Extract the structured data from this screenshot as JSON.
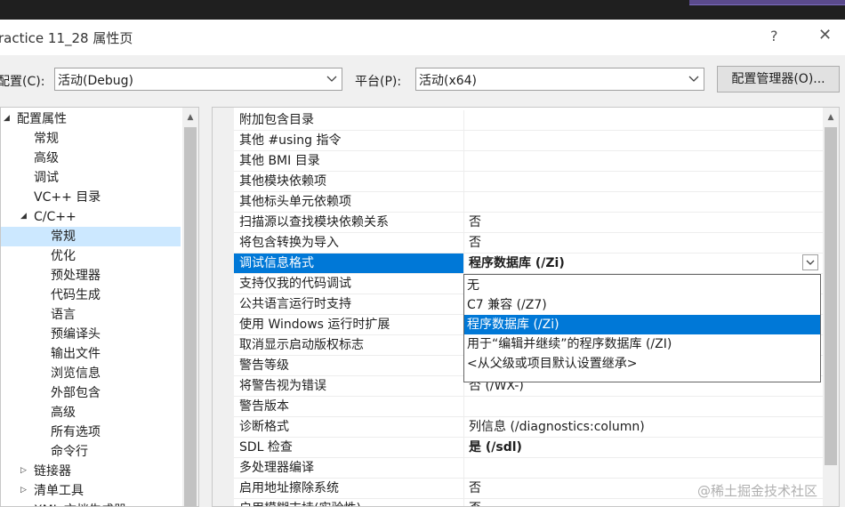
{
  "window": {
    "title": "ractice 11_28 属性页",
    "help": "?",
    "close": "✕"
  },
  "config": {
    "config_label": "配置(C):",
    "config_value": "活动(Debug)",
    "platform_label": "平台(P):",
    "platform_value": "活动(x64)",
    "manager_button": "配置管理器(O)..."
  },
  "tree": {
    "items": [
      {
        "label": "配置属性",
        "level": 0,
        "expander": "◢"
      },
      {
        "label": "常规",
        "level": 1
      },
      {
        "label": "高级",
        "level": 1
      },
      {
        "label": "调试",
        "level": 1
      },
      {
        "label": "VC++ 目录",
        "level": 1
      },
      {
        "label": "C/C++",
        "level": 1,
        "expander": "◢"
      },
      {
        "label": "常规",
        "level": 2,
        "selected": true
      },
      {
        "label": "优化",
        "level": 2
      },
      {
        "label": "预处理器",
        "level": 2
      },
      {
        "label": "代码生成",
        "level": 2
      },
      {
        "label": "语言",
        "level": 2
      },
      {
        "label": "预编译头",
        "level": 2
      },
      {
        "label": "输出文件",
        "level": 2
      },
      {
        "label": "浏览信息",
        "level": 2
      },
      {
        "label": "外部包含",
        "level": 2
      },
      {
        "label": "高级",
        "level": 2
      },
      {
        "label": "所有选项",
        "level": 2
      },
      {
        "label": "命令行",
        "level": 2
      },
      {
        "label": "链接器",
        "level": 1,
        "expander": "▷"
      },
      {
        "label": "清单工具",
        "level": 1,
        "expander": "▷"
      },
      {
        "label": "XML 文档生成器",
        "level": 1,
        "expander": "▷"
      }
    ]
  },
  "properties": {
    "rows": [
      {
        "name": "附加包含目录",
        "value": ""
      },
      {
        "name": "其他 #using 指令",
        "value": ""
      },
      {
        "name": "其他 BMI 目录",
        "value": ""
      },
      {
        "name": "其他模块依赖项",
        "value": ""
      },
      {
        "name": "其他标头单元依赖项",
        "value": ""
      },
      {
        "name": "扫描源以查找模块依赖关系",
        "value": "否"
      },
      {
        "name": "将包含转换为导入",
        "value": "否"
      },
      {
        "name": "调试信息格式",
        "value": "程序数据库 (/Zi)",
        "bold": true,
        "selected": true
      },
      {
        "name": "支持仅我的代码调试",
        "value": ""
      },
      {
        "name": "公共语言运行时支持",
        "value": ""
      },
      {
        "name": "使用 Windows 运行时扩展",
        "value": ""
      },
      {
        "name": "取消显示启动版权标志",
        "value": ""
      },
      {
        "name": "警告等级",
        "value": ""
      },
      {
        "name": "将警告视为错误",
        "value": "否 (/WX-)"
      },
      {
        "name": "警告版本",
        "value": ""
      },
      {
        "name": "诊断格式",
        "value": "列信息 (/diagnostics:column)"
      },
      {
        "name": "SDL 检查",
        "value": "是 (/sdl)",
        "bold": true
      },
      {
        "name": "多处理器编译",
        "value": ""
      },
      {
        "name": "启用地址擦除系统",
        "value": "否"
      },
      {
        "name": "启用模糊支持(实验性)",
        "value": "否"
      }
    ]
  },
  "dropdown": {
    "options": [
      {
        "label": "无"
      },
      {
        "label": "C7 兼容 (/Z7)"
      },
      {
        "label": "程序数据库 (/Zi)",
        "highlighted": true
      },
      {
        "label": "用于“编辑并继续”的程序数据库 (/ZI)"
      },
      {
        "label": "<从父级或项目默认设置继承>"
      }
    ]
  },
  "watermark": "@稀土掘金技术社区",
  "colors": {
    "selection_blue": "#0078d7",
    "tree_selection": "#cce8ff",
    "background": "#f0f0f0"
  }
}
